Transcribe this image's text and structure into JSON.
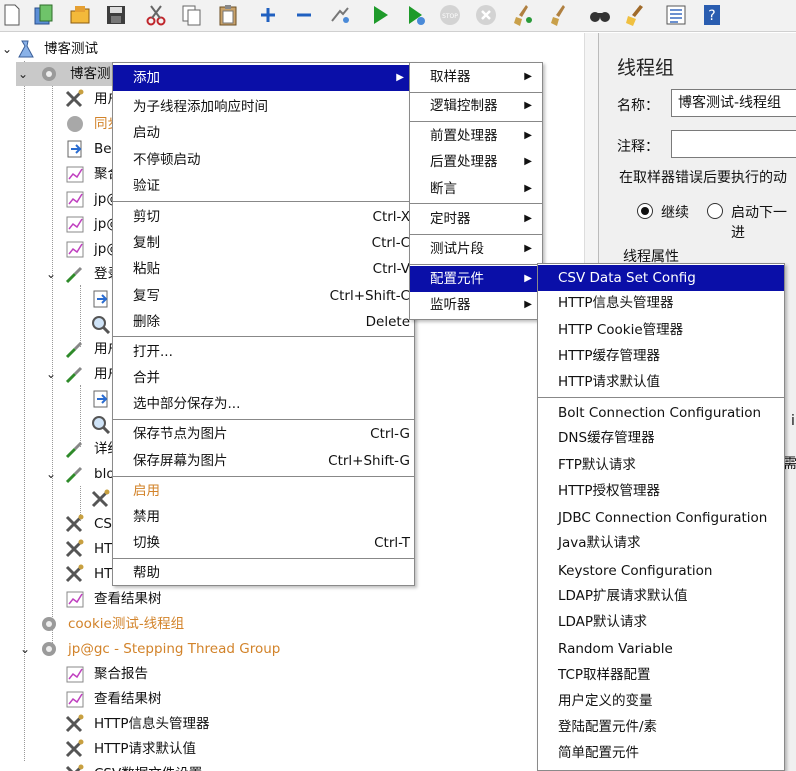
{
  "toolbar": {
    "icons": [
      "new-icon",
      "templates-icon",
      "open-icon",
      "save-icon",
      "cut-icon",
      "copy-icon",
      "paste-icon",
      "expand-icon",
      "collapse-icon",
      "toggle-icon",
      "start-icon",
      "start-no-pause-icon",
      "stop-icon",
      "shutdown-icon",
      "clear-icon",
      "clear-all-icon",
      "search-icon",
      "reset-search-icon",
      "function-helper-icon",
      "help-icon"
    ]
  },
  "tree": {
    "root": "博客测试",
    "thread_group": "博客测",
    "items": {
      "i1": "用户",
      "i2": "同步",
      "i3": "Bea",
      "i4": "聚合",
      "i5": "jp@",
      "i6": "jp@",
      "i7": "jp@",
      "i8": "登录",
      "i11": "用户",
      "i12": "用户",
      "i15": "详细",
      "i16": "blo",
      "i18": "CSV",
      "i19": "HTT",
      "i20": "HTT",
      "i21": "查看结果树",
      "i22": "cookie测试-线程组",
      "i23": "jp@gc - Stepping Thread Group",
      "i24": "聚合报告",
      "i25": "查看结果树",
      "i26": "HTTP信息头管理器",
      "i27": "HTTP请求默认值",
      "i28": "CSV数据文件设置"
    }
  },
  "panel": {
    "title": "线程组",
    "name_label": "名称：",
    "name_value": "博客测试-线程组",
    "comment_label": "注释：",
    "comment_value": "",
    "error_action_label": "在取样器错误后要执行的动",
    "radio_continue": "继续",
    "radio_next": "启动下一进",
    "thread_props": "线程属性",
    "frag_i": "i",
    "frag_need": "需"
  },
  "context_menu": {
    "add": "添加",
    "add_think_time": "为子线程添加响应时间",
    "start": "启动",
    "start_no_pause": "不停顿启动",
    "validate": "验证",
    "cut": "剪切",
    "cut_acc": "Ctrl-X",
    "copy": "复制",
    "copy_acc": "Ctrl-C",
    "paste": "粘贴",
    "paste_acc": "Ctrl-V",
    "duplicate": "复写",
    "duplicate_acc": "Ctrl+Shift-C",
    "remove": "删除",
    "remove_acc": "Delete",
    "open": "打开...",
    "merge": "合并",
    "save_selection": "选中部分保存为...",
    "save_node_image": "保存节点为图片",
    "save_node_image_acc": "Ctrl-G",
    "save_screen_image": "保存屏幕为图片",
    "save_screen_image_acc": "Ctrl+Shift-G",
    "enable": "启用",
    "disable": "禁用",
    "toggle": "切换",
    "toggle_acc": "Ctrl-T",
    "help": "帮助"
  },
  "add_menu": {
    "sampler": "取样器",
    "logic_controller": "逻辑控制器",
    "pre_processor": "前置处理器",
    "post_processor": "后置处理器",
    "assertion": "断言",
    "timer": "定时器",
    "test_fragment": "测试片段",
    "config_element": "配置元件",
    "listener": "监听器"
  },
  "config_menu": {
    "csv_data_set": "CSV Data Set Config",
    "http_header_manager": "HTTP信息头管理器",
    "http_cookie_manager": "HTTP Cookie管理器",
    "http_cache_manager": "HTTP缓存管理器",
    "http_request_defaults": "HTTP请求默认值",
    "bolt_connection": "Bolt Connection Configuration",
    "dns_cache_manager": "DNS缓存管理器",
    "ftp_defaults": "FTP默认请求",
    "http_auth_manager": "HTTP授权管理器",
    "jdbc_connection": "JDBC Connection Configuration",
    "java_defaults": "Java默认请求",
    "keystore_config": "Keystore Configuration",
    "ldap_ext_defaults": "LDAP扩展请求默认值",
    "ldap_defaults": "LDAP默认请求",
    "random_variable": "Random Variable",
    "tcp_sampler_config": "TCP取样器配置",
    "user_defined_vars": "用户定义的变量",
    "login_config": "登陆配置元件/素",
    "simple_config": "简单配置元件"
  },
  "colors": {
    "highlight": "#0a0fa8",
    "disabled_text": "#d2832a",
    "selected_row": "#c9c9c9"
  }
}
